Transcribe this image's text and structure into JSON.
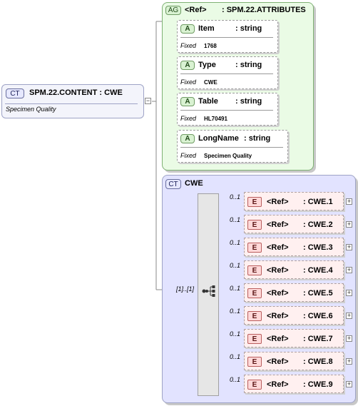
{
  "root": {
    "badge": "CT",
    "title": "SPM.22.CONTENT : CWE",
    "description": "Specimen Quality"
  },
  "attribute_group": {
    "badge": "AG",
    "ref_label": "<Ref>",
    "name": ": SPM.22.ATTRIBUTES",
    "attributes": [
      {
        "badge": "A",
        "name": "Item",
        "type": ": string",
        "fixed_label": "Fixed",
        "fixed_value": "1768"
      },
      {
        "badge": "A",
        "name": "Type",
        "type": ": string",
        "fixed_label": "Fixed",
        "fixed_value": "CWE"
      },
      {
        "badge": "A",
        "name": "Table",
        "type": ": string",
        "fixed_label": "Fixed",
        "fixed_value": "HL70491"
      },
      {
        "badge": "A",
        "name": "LongName",
        "type": ": string",
        "fixed_label": "Fixed",
        "fixed_value": "Specimen Quality"
      }
    ]
  },
  "complex_type": {
    "badge": "CT",
    "name": "CWE",
    "sequence_occurrence": "[1]..[1]",
    "elements": [
      {
        "occurrence": "0..1",
        "badge": "E",
        "ref": "<Ref>",
        "name": ": CWE.1"
      },
      {
        "occurrence": "0..1",
        "badge": "E",
        "ref": "<Ref>",
        "name": ": CWE.2"
      },
      {
        "occurrence": "0..1",
        "badge": "E",
        "ref": "<Ref>",
        "name": ": CWE.3"
      },
      {
        "occurrence": "0..1",
        "badge": "E",
        "ref": "<Ref>",
        "name": ": CWE.4"
      },
      {
        "occurrence": "0..1",
        "badge": "E",
        "ref": "<Ref>",
        "name": ": CWE.5"
      },
      {
        "occurrence": "0..1",
        "badge": "E",
        "ref": "<Ref>",
        "name": ": CWE.6"
      },
      {
        "occurrence": "0..1",
        "badge": "E",
        "ref": "<Ref>",
        "name": ": CWE.7"
      },
      {
        "occurrence": "0..1",
        "badge": "E",
        "ref": "<Ref>",
        "name": ": CWE.8"
      },
      {
        "occurrence": "0..1",
        "badge": "E",
        "ref": "<Ref>",
        "name": ": CWE.9"
      }
    ]
  },
  "icons": {
    "expand": "plus-icon",
    "collapse": "minus-icon",
    "sequence": "sequence-icon"
  },
  "colors": {
    "attribute_group_bg": "#eafbe5",
    "complex_type_bg": "#e2e3ff",
    "element_bg": "#fff0f0"
  }
}
